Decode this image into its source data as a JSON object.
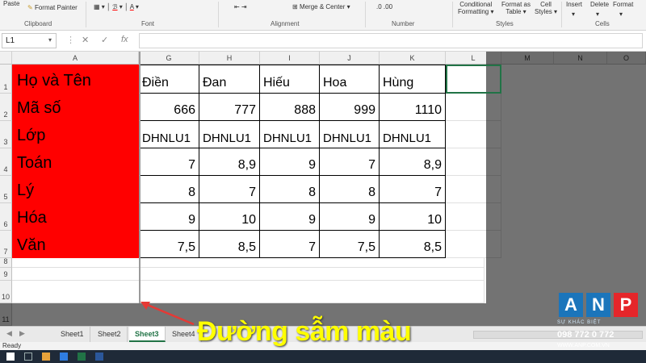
{
  "ribbon": {
    "paste": "Paste",
    "format_painter": "Format Painter",
    "clipboard": "Clipboard",
    "font": "Font",
    "merge_center": "Merge & Center",
    "alignment": "Alignment",
    "number": "Number",
    "conditional_formatting_1": "Conditional",
    "conditional_formatting_2": "Formatting",
    "format_as_table_1": "Format as",
    "format_as_table_2": "Table",
    "cell_styles_1": "Cell",
    "cell_styles_2": "Styles",
    "styles": "Styles",
    "insert": "Insert",
    "delete": "Delete",
    "format": "Format",
    "cells": "Cells"
  },
  "formula_bar": {
    "name_box": "L1",
    "fx": "fx",
    "value": ""
  },
  "columns": [
    "A",
    "G",
    "H",
    "I",
    "J",
    "K",
    "L",
    "M",
    "N",
    "O"
  ],
  "rows": [
    "1",
    "2",
    "3",
    "4",
    "5",
    "6",
    "7",
    "8",
    "9",
    "10",
    "11"
  ],
  "table": [
    {
      "label": "Họ và Tên",
      "values": [
        "Điền",
        "Đan",
        "Hiếu",
        "Hoa",
        "Hùng"
      ]
    },
    {
      "label": "Mã số",
      "values": [
        "666",
        "777",
        "888",
        "999",
        "1110"
      ]
    },
    {
      "label": "Lớp",
      "values": [
        "DHNLU1",
        "DHNLU1",
        "DHNLU1",
        "DHNLU1",
        "DHNLU1"
      ]
    },
    {
      "label": "Toán",
      "values": [
        "7",
        "8,9",
        "9",
        "7",
        "8,9"
      ]
    },
    {
      "label": "Lý",
      "values": [
        "8",
        "7",
        "8",
        "8",
        "7"
      ]
    },
    {
      "label": "Hóa",
      "values": [
        "9",
        "10",
        "9",
        "9",
        "10"
      ]
    },
    {
      "label": "Văn",
      "values": [
        "7,5",
        "8,5",
        "7",
        "7,5",
        "8,5"
      ]
    }
  ],
  "sheets": [
    {
      "name": "Sheet1",
      "active": false
    },
    {
      "name": "Sheet2",
      "active": false
    },
    {
      "name": "Sheet3",
      "active": true
    },
    {
      "name": "Sheet4",
      "active": false
    }
  ],
  "status": "Ready",
  "annotation": "Đường sẫm màu",
  "logo": {
    "a": "A",
    "n": "N",
    "p": "P",
    "subtitle": "SỰ KHÁC BIỆT",
    "phone": "098 772 0 772",
    "web": "WWW.ANP.COM.VN"
  },
  "colors": {
    "label_fill": "#ff0000",
    "selection": "#217346",
    "annotation": "#ffff00",
    "logo_blue": "#1b75bb",
    "logo_red": "#e5262a"
  }
}
